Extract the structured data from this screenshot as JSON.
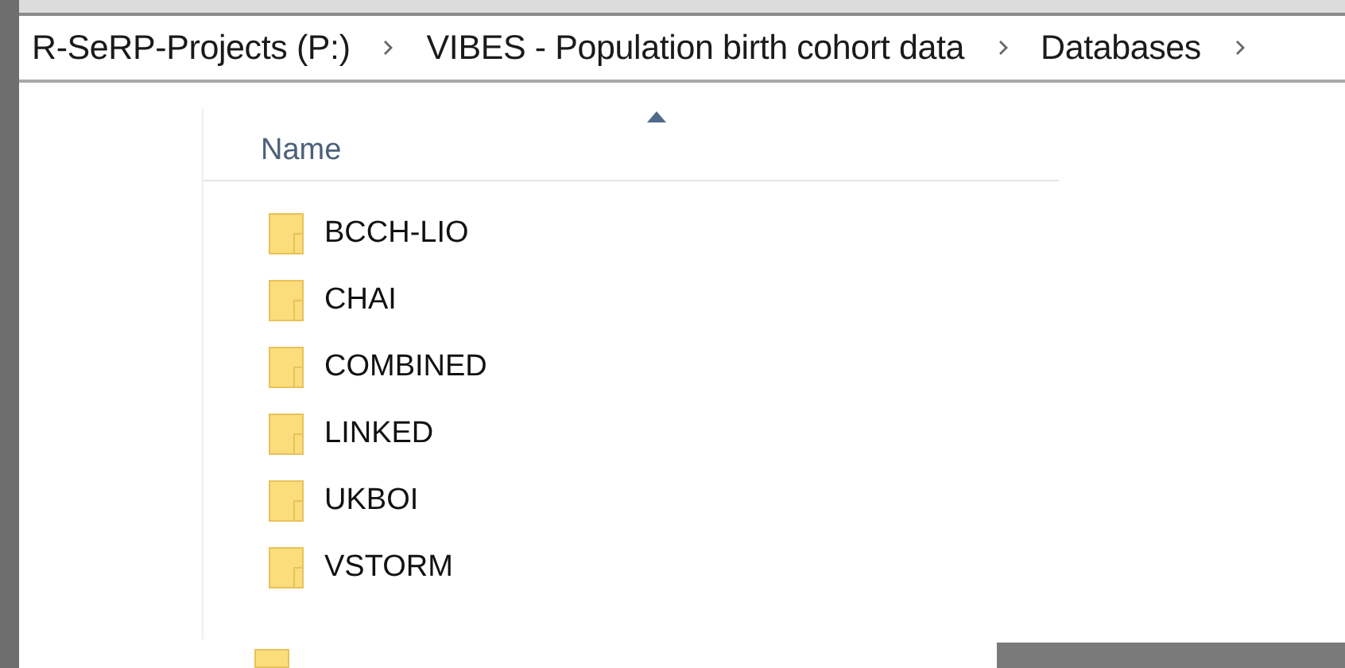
{
  "breadcrumb": [
    {
      "label": "R-SeRP-Projects (P:)"
    },
    {
      "label": "VIBES - Population birth cohort data"
    },
    {
      "label": "Databases"
    }
  ],
  "file_list": {
    "columns": [
      {
        "label": "Name",
        "sorted": true
      }
    ],
    "rows": [
      {
        "name": "BCCH-LIO"
      },
      {
        "name": "CHAI"
      },
      {
        "name": "COMBINED"
      },
      {
        "name": "LINKED"
      },
      {
        "name": "UKBOI"
      },
      {
        "name": "VSTORM"
      }
    ]
  }
}
